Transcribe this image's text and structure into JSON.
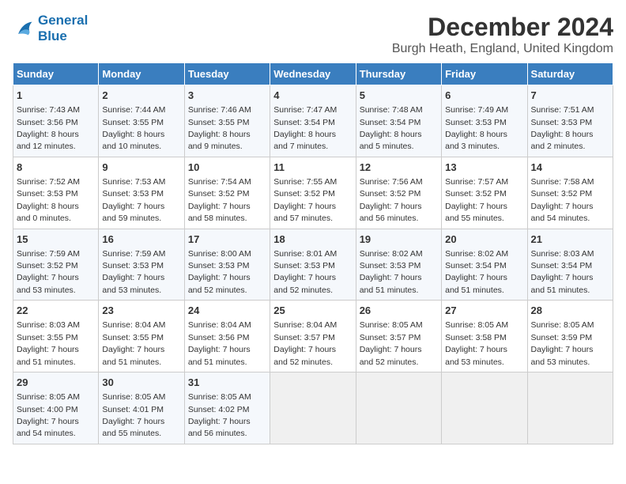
{
  "logo": {
    "line1": "General",
    "line2": "Blue"
  },
  "title": "December 2024",
  "subtitle": "Burgh Heath, England, United Kingdom",
  "columns": [
    "Sunday",
    "Monday",
    "Tuesday",
    "Wednesday",
    "Thursday",
    "Friday",
    "Saturday"
  ],
  "weeks": [
    [
      {
        "day": "1",
        "info": "Sunrise: 7:43 AM\nSunset: 3:56 PM\nDaylight: 8 hours\nand 12 minutes."
      },
      {
        "day": "2",
        "info": "Sunrise: 7:44 AM\nSunset: 3:55 PM\nDaylight: 8 hours\nand 10 minutes."
      },
      {
        "day": "3",
        "info": "Sunrise: 7:46 AM\nSunset: 3:55 PM\nDaylight: 8 hours\nand 9 minutes."
      },
      {
        "day": "4",
        "info": "Sunrise: 7:47 AM\nSunset: 3:54 PM\nDaylight: 8 hours\nand 7 minutes."
      },
      {
        "day": "5",
        "info": "Sunrise: 7:48 AM\nSunset: 3:54 PM\nDaylight: 8 hours\nand 5 minutes."
      },
      {
        "day": "6",
        "info": "Sunrise: 7:49 AM\nSunset: 3:53 PM\nDaylight: 8 hours\nand 3 minutes."
      },
      {
        "day": "7",
        "info": "Sunrise: 7:51 AM\nSunset: 3:53 PM\nDaylight: 8 hours\nand 2 minutes."
      }
    ],
    [
      {
        "day": "8",
        "info": "Sunrise: 7:52 AM\nSunset: 3:53 PM\nDaylight: 8 hours\nand 0 minutes."
      },
      {
        "day": "9",
        "info": "Sunrise: 7:53 AM\nSunset: 3:53 PM\nDaylight: 7 hours\nand 59 minutes."
      },
      {
        "day": "10",
        "info": "Sunrise: 7:54 AM\nSunset: 3:52 PM\nDaylight: 7 hours\nand 58 minutes."
      },
      {
        "day": "11",
        "info": "Sunrise: 7:55 AM\nSunset: 3:52 PM\nDaylight: 7 hours\nand 57 minutes."
      },
      {
        "day": "12",
        "info": "Sunrise: 7:56 AM\nSunset: 3:52 PM\nDaylight: 7 hours\nand 56 minutes."
      },
      {
        "day": "13",
        "info": "Sunrise: 7:57 AM\nSunset: 3:52 PM\nDaylight: 7 hours\nand 55 minutes."
      },
      {
        "day": "14",
        "info": "Sunrise: 7:58 AM\nSunset: 3:52 PM\nDaylight: 7 hours\nand 54 minutes."
      }
    ],
    [
      {
        "day": "15",
        "info": "Sunrise: 7:59 AM\nSunset: 3:52 PM\nDaylight: 7 hours\nand 53 minutes."
      },
      {
        "day": "16",
        "info": "Sunrise: 7:59 AM\nSunset: 3:53 PM\nDaylight: 7 hours\nand 53 minutes."
      },
      {
        "day": "17",
        "info": "Sunrise: 8:00 AM\nSunset: 3:53 PM\nDaylight: 7 hours\nand 52 minutes."
      },
      {
        "day": "18",
        "info": "Sunrise: 8:01 AM\nSunset: 3:53 PM\nDaylight: 7 hours\nand 52 minutes."
      },
      {
        "day": "19",
        "info": "Sunrise: 8:02 AM\nSunset: 3:53 PM\nDaylight: 7 hours\nand 51 minutes."
      },
      {
        "day": "20",
        "info": "Sunrise: 8:02 AM\nSunset: 3:54 PM\nDaylight: 7 hours\nand 51 minutes."
      },
      {
        "day": "21",
        "info": "Sunrise: 8:03 AM\nSunset: 3:54 PM\nDaylight: 7 hours\nand 51 minutes."
      }
    ],
    [
      {
        "day": "22",
        "info": "Sunrise: 8:03 AM\nSunset: 3:55 PM\nDaylight: 7 hours\nand 51 minutes."
      },
      {
        "day": "23",
        "info": "Sunrise: 8:04 AM\nSunset: 3:55 PM\nDaylight: 7 hours\nand 51 minutes."
      },
      {
        "day": "24",
        "info": "Sunrise: 8:04 AM\nSunset: 3:56 PM\nDaylight: 7 hours\nand 51 minutes."
      },
      {
        "day": "25",
        "info": "Sunrise: 8:04 AM\nSunset: 3:57 PM\nDaylight: 7 hours\nand 52 minutes."
      },
      {
        "day": "26",
        "info": "Sunrise: 8:05 AM\nSunset: 3:57 PM\nDaylight: 7 hours\nand 52 minutes."
      },
      {
        "day": "27",
        "info": "Sunrise: 8:05 AM\nSunset: 3:58 PM\nDaylight: 7 hours\nand 53 minutes."
      },
      {
        "day": "28",
        "info": "Sunrise: 8:05 AM\nSunset: 3:59 PM\nDaylight: 7 hours\nand 53 minutes."
      }
    ],
    [
      {
        "day": "29",
        "info": "Sunrise: 8:05 AM\nSunset: 4:00 PM\nDaylight: 7 hours\nand 54 minutes."
      },
      {
        "day": "30",
        "info": "Sunrise: 8:05 AM\nSunset: 4:01 PM\nDaylight: 7 hours\nand 55 minutes."
      },
      {
        "day": "31",
        "info": "Sunrise: 8:05 AM\nSunset: 4:02 PM\nDaylight: 7 hours\nand 56 minutes."
      },
      null,
      null,
      null,
      null
    ]
  ]
}
